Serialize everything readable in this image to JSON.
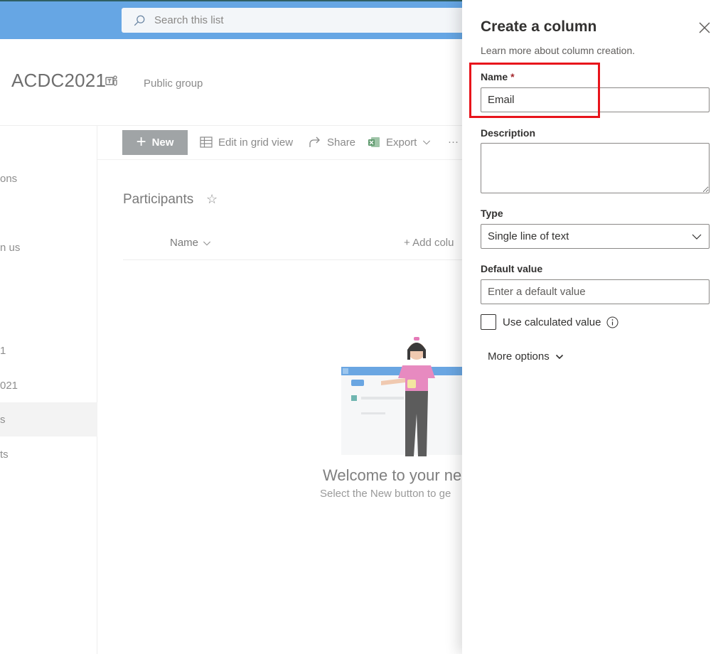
{
  "header": {
    "search_placeholder": "Search this list"
  },
  "site": {
    "title": "ACDC2021",
    "group_type": "Public group"
  },
  "nav": {
    "items": [
      {
        "label": "ons"
      },
      {
        "label": "n us"
      },
      {
        "label": "1"
      },
      {
        "label": "021"
      },
      {
        "label": "s"
      },
      {
        "label": "ts"
      }
    ]
  },
  "commandbar": {
    "new_label": "New",
    "edit_grid_label": "Edit in grid view",
    "share_label": "Share",
    "export_label": "Export",
    "more_label": "···"
  },
  "list": {
    "title": "Participants",
    "column_name": "Name",
    "add_column": "+ Add colu"
  },
  "empty_state": {
    "title": "Welcome to your ne",
    "subtitle": "Select the New button to ge"
  },
  "panel": {
    "title": "Create a column",
    "learn_more": "Learn more about column creation.",
    "name_label": "Name",
    "name_required": "*",
    "name_value": "Email",
    "description_label": "Description",
    "description_value": "",
    "type_label": "Type",
    "type_value": "Single line of text",
    "default_label": "Default value",
    "default_placeholder": "Enter a default value",
    "calculated_label": "Use calculated value",
    "more_options": "More options"
  },
  "colors": {
    "topbar": "#66a6e4",
    "highlight": "#e8141b",
    "required": "#a4262c"
  }
}
